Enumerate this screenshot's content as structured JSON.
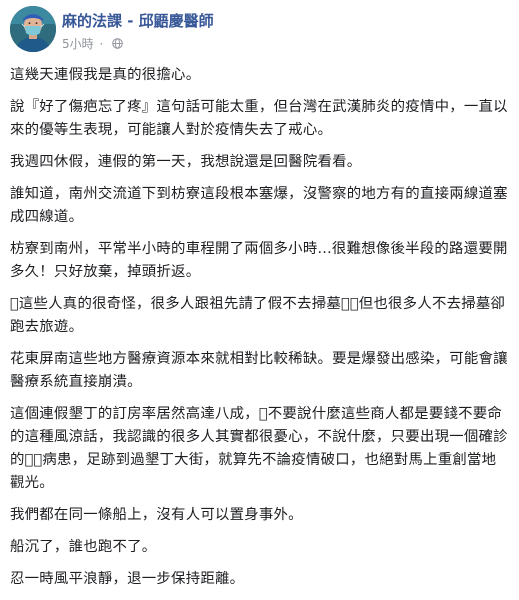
{
  "post": {
    "author": "麻的法課 - 邱鼯慶醫師",
    "time": "5小時",
    "separator": "·",
    "privacy_icon": "globe-icon",
    "paragraphs": [
      "這幾天連假我是真的很擔心。",
      "說『好了傷疤忘了疼』這句話可能太重，但台灣在武漢肺炎的疫情中，一直以來的優等生表現，可能讓人對於疫情失去了戒心。",
      "我週四休假，連假的第一天，我想說還是回醫院看看。",
      "誰知道，南州交流道下到枋寮這段根本塞爆，沒警察的地方有的直接兩線道塞成四線道。",
      "枋寮到南州，平常半小時的車程開了兩個多小時...很難想像後半段的路還要開多久！只好放棄，掉頭折返。",
      "󾓴這些人真的很奇怪，很多人跟祖先請了假不去掃墓󾓴，但也很多人不去掃墓卻跑去旅遊。",
      "花東屏南這些地方醫療資源本來就相對比較稀缺。要是爆發出感染，可能會讓醫療系統直接崩潰。",
      "這個連假墾丁的訂房率居然高達八成，󾓴不要說什麼這些商人都是要錢不要命的這種風涼話，我認識的很多人其實都很憂心，不說什麼，只要出現一個確診的󾓴󾓴病患，足跡到過墾丁大街，就算先不論疫情破口，也絕對馬上重創當地觀光。",
      "我們都在同一條船上，沒有人可以置身事外。",
      "船沉了，誰也跑不了。",
      "忍一時風平浪靜，退一步保持距離。"
    ]
  },
  "colors": {
    "author": "#385898",
    "meta": "#90949c",
    "text": "#1c1e21",
    "avatar_bg": "#2f6d7e"
  }
}
